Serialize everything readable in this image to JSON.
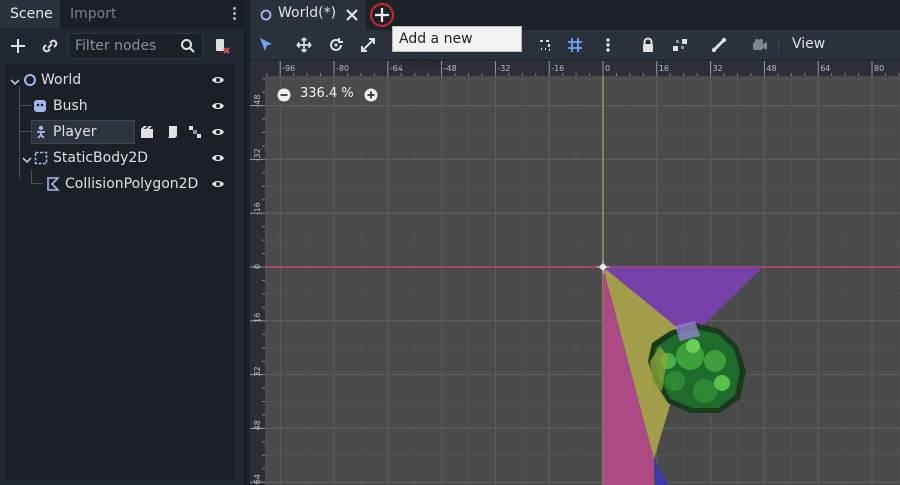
{
  "dock": {
    "tabs": [
      "Scene",
      "Import"
    ],
    "filter_placeholder": "Filter nodes",
    "tree": [
      {
        "label": "World",
        "icon": "node2d-icon"
      },
      {
        "label": "Bush",
        "icon": "instance-icon"
      },
      {
        "label": "Player",
        "icon": "player-scene-icon"
      },
      {
        "label": "StaticBody2D",
        "icon": "staticbody2d-icon"
      },
      {
        "label": "CollisionPolygon2D",
        "icon": "collisionpolygon2d-icon"
      }
    ]
  },
  "scene_tabs": {
    "current": "World(*)",
    "tooltip": "Add a new scene."
  },
  "toolbar": {
    "view_label": "View"
  },
  "viewport": {
    "zoom": "336.4 %",
    "ruler_top": [
      "-96",
      "-80",
      "-64",
      "-48",
      "-32",
      "-16",
      "0",
      "16",
      "32",
      "48",
      "64",
      "80"
    ],
    "ruler_left": [
      "-48",
      "-32",
      "-16",
      "0",
      "16",
      "32",
      "48",
      "64"
    ]
  },
  "colors": {
    "accent": "#d6d8dc",
    "x_axis": "#d24a6b",
    "y_axis": "#9bd04a",
    "highlight_ring": "#c0282f"
  }
}
